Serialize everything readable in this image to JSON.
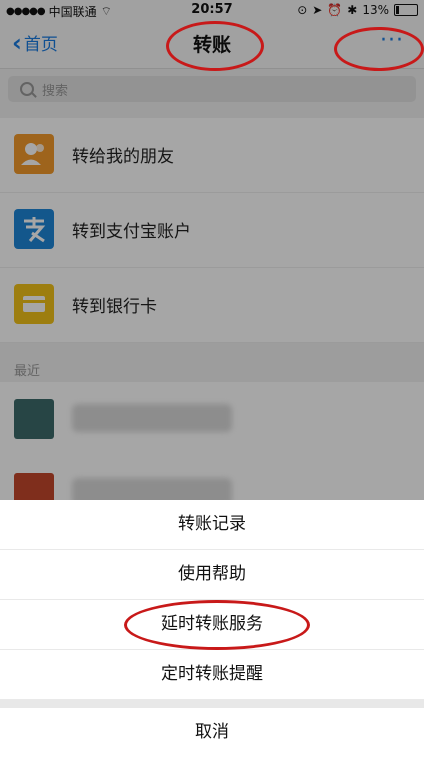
{
  "status": {
    "carrier": "中国联通",
    "time": "20:57",
    "battery": "13%"
  },
  "nav": {
    "back": "首页",
    "title": "转账",
    "more": "···"
  },
  "search": {
    "placeholder": "搜索"
  },
  "list": {
    "items": [
      {
        "label": "转给我的朋友",
        "icon": "friends-icon",
        "color": "#f39a2b"
      },
      {
        "label": "转到支付宝账户",
        "icon": "alipay-icon",
        "color": "#1e86d8"
      },
      {
        "label": "转到银行卡",
        "icon": "bankcard-icon",
        "color": "#f2c21a"
      }
    ]
  },
  "recent": {
    "section": "最近"
  },
  "sheet": {
    "options": [
      {
        "label": "转账记录"
      },
      {
        "label": "使用帮助"
      },
      {
        "label": "延时转账服务"
      },
      {
        "label": "定时转账提醒"
      }
    ],
    "cancel": "取消"
  }
}
